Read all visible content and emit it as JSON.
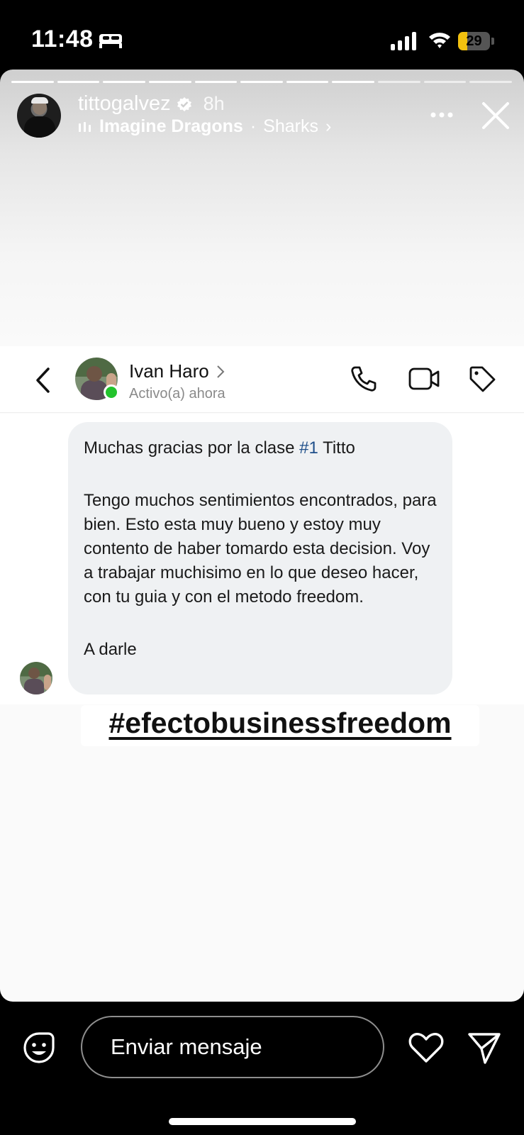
{
  "status_bar": {
    "time": "11:48",
    "battery_level": "29",
    "battery_fraction": 0.29,
    "icons": [
      "sleep-icon",
      "signal-icon",
      "wifi-icon",
      "battery-icon"
    ]
  },
  "story": {
    "username": "tittogalvez",
    "verified": true,
    "time_ago": "8h",
    "music": {
      "artist": "Imagine Dragons",
      "separator": "·",
      "song": "Sharks",
      "chevron": "›"
    },
    "progress_segments_total": 11,
    "progress_segments_viewed": 8
  },
  "dm": {
    "contact_name": "Ivan Haro",
    "status": "Activo(a) ahora",
    "message": {
      "line1_prefix": "Muchas gracias por la clase ",
      "line1_hashtag": "#1",
      "line1_suffix": " Titto",
      "paragraph2": "Tengo muchos sentimientos encontrados, para bien.  Esto esta muy bueno y estoy muy contento de haber tomardo esta decision.  Voy a trabajar muchisimo en lo que deseo hacer,  con tu guia y con el metodo freedom.",
      "paragraph3": "A darle"
    }
  },
  "caption": "#efectobusinessfreedom",
  "reply_bar": {
    "placeholder": "Enviar mensaje"
  },
  "colors": {
    "online": "#22c32c",
    "battery": "#f2c10f",
    "hashtag": "#1f4f8a",
    "bubble": "#eff1f3"
  }
}
